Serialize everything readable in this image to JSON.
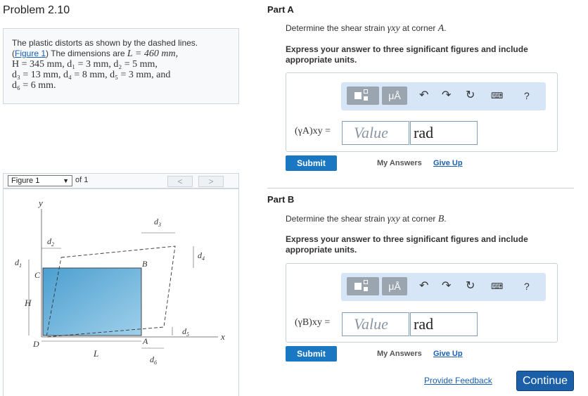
{
  "problem": {
    "title": "Problem 2.10",
    "intro": "The plastic distorts as shown by the dashed lines.",
    "figure_link": "Figure 1",
    "line2_text": " The dimensions are ",
    "L": "L = 460 mm,",
    "H": "H = 345 mm, d₁ = 3 mm, d₂ = 5 mm,",
    "d3": "d₃ = 13 mm, d₄ = 8 mm, d₅ = 3 mm, and",
    "d6": "d₆ = 6 mm."
  },
  "figure": {
    "select_value": "Figure 1",
    "of_text": "of 1",
    "prev": "<",
    "next": ">",
    "labels": {
      "y": "y",
      "x": "x",
      "B": "B",
      "C": "C",
      "A": "A",
      "D": "D",
      "H": "H",
      "L": "L",
      "d1": "d",
      "d2": "d",
      "d3": "d",
      "d4": "d",
      "d5": "d",
      "d6": "d",
      "s1": "1",
      "s2": "2",
      "s3": "3",
      "s4": "4",
      "s5": "5",
      "s6": "6"
    }
  },
  "partA": {
    "title": "Part A",
    "question_prefix": "Determine the shear strain ",
    "symbol": "γxy",
    "question_suffix": " at corner ",
    "corner": "A",
    "instruction": "Express your answer to three significant figures and include appropriate units.",
    "answer_label": "(γA)xy =",
    "value_placeholder": "Value",
    "unit_value": "rad",
    "submit": "Submit",
    "my_answers": "My Answers",
    "give_up": "Give Up"
  },
  "partB": {
    "title": "Part B",
    "question_prefix": "Determine the shear strain ",
    "symbol": "γxy",
    "question_suffix": " at corner ",
    "corner": "B",
    "instruction": "Express your answer to three significant figures and include appropriate units.",
    "answer_label": "(γB)xy =",
    "value_placeholder": "Value",
    "unit_value": "rad",
    "submit": "Submit",
    "my_answers": "My Answers",
    "give_up": "Give Up"
  },
  "toolbar": {
    "templates_icon": "templates-icon",
    "units_label": "μÅ",
    "undo_icon": "undo-icon",
    "redo_icon": "redo-icon",
    "reset_icon": "reset-icon",
    "keyboard_icon": "keyboard-icon",
    "help_label": "?"
  },
  "footer": {
    "provide_feedback": "Provide Feedback",
    "continue": "Continue"
  },
  "colors": {
    "accent": "#1a78c2",
    "continue": "#1a5fa8",
    "toolbar_bg": "#d7e6f7",
    "plate_fill": "#5aa7d2"
  }
}
